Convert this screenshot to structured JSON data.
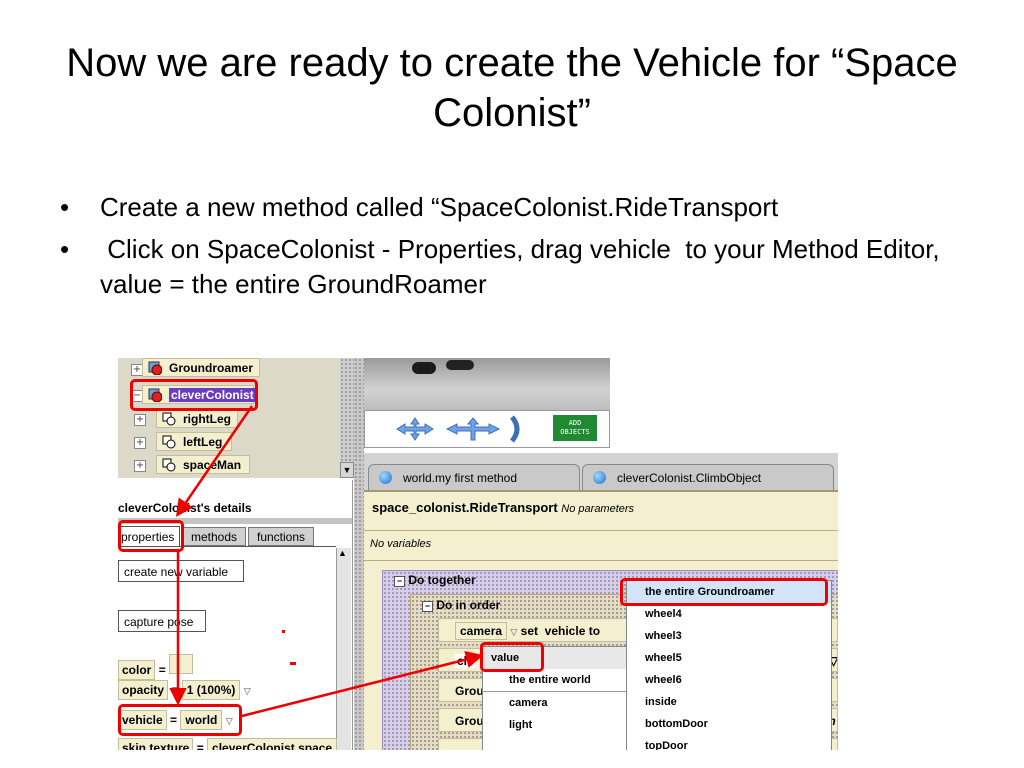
{
  "slide": {
    "title": "Now we are ready to create the Vehicle for “Space Colonist”",
    "bullets": [
      "Create a new method called “SpaceColonist.RideTransport",
      " Click on SpaceColonist - Properties, drag vehicle  to your Method Editor, value = the entire GroundRoamer"
    ]
  },
  "object_tree": {
    "items": [
      "Groundroamer",
      "cleverColonist",
      "rightLeg",
      "leftLeg",
      "spaceMan"
    ]
  },
  "scene": {
    "add_objects_label": "ADD\nOBJECTS"
  },
  "details": {
    "header": "cleverColonist's details",
    "tabs": [
      "properties",
      "methods",
      "functions"
    ],
    "create_variable_button": "create new variable",
    "capture_pose_button": "capture pose",
    "properties": [
      {
        "name": "color",
        "value": "="
      },
      {
        "name": "opacity",
        "value": "1 (100%)"
      },
      {
        "name": "vehicle",
        "value": "world"
      },
      {
        "name": "skin texture",
        "value": "cleverColonist.space"
      }
    ]
  },
  "editor": {
    "tabs": [
      "world.my first method",
      "cleverColonist.ClimbObject"
    ],
    "method_name": "space_colonist.RideTransport",
    "no_parameters": "No parameters",
    "no_variables": "No variables",
    "do_together": "Do together",
    "do_in_order": "Do in order",
    "statement_camera_obj": "camera",
    "statement_camera_action": "set  vehicle to",
    "row_prefixes": [
      "cle",
      "Grou",
      "Grou"
    ]
  },
  "value_menu": {
    "items": [
      "value",
      "the entire world",
      "camera",
      "light"
    ]
  },
  "object_menu": {
    "items": [
      "the entire Groundroamer",
      "wheel4",
      "wheel3",
      "wheel5",
      "wheel6",
      "inside",
      "bottomDoor",
      "topDoor"
    ]
  },
  "colors": {
    "highlight": "#e00000",
    "selected_object": "#6a3dc0",
    "panel_beige": "#f4efcf",
    "editor_lavender": "#d8ccf0"
  }
}
